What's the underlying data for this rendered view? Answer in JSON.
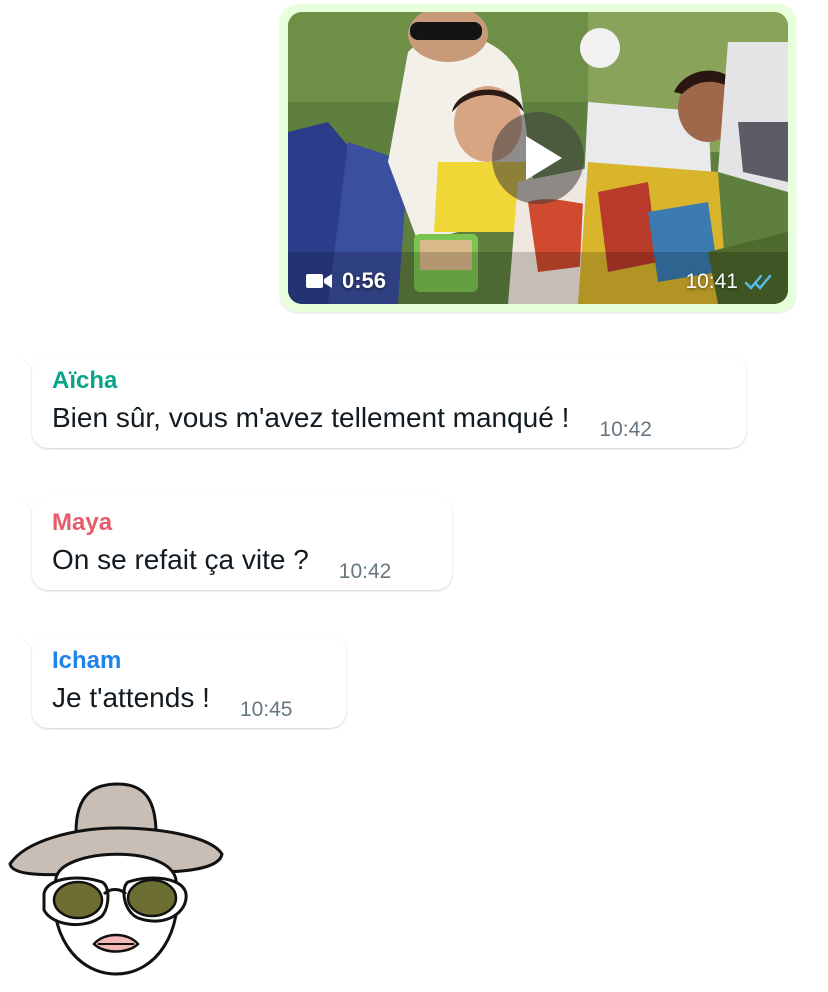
{
  "video_message": {
    "duration": "0:56",
    "time": "10:41",
    "status": "read"
  },
  "messages": [
    {
      "sender": "Aïcha",
      "sender_color": "#07a58a",
      "text": "Bien sûr, vous m'avez tellement manqué !",
      "time": "10:42"
    },
    {
      "sender": "Maya",
      "sender_color": "#e85c6a",
      "text": "On se refait ça vite ?",
      "time": "10:42"
    },
    {
      "sender": "Icham",
      "sender_color": "#1f83e9",
      "text": "Je t'attends !",
      "time": "10:45"
    }
  ],
  "colors": {
    "outgoing_bubble": "#e7ffdb",
    "read_ticks": "#53bdeb",
    "timestamp": "#667781"
  }
}
